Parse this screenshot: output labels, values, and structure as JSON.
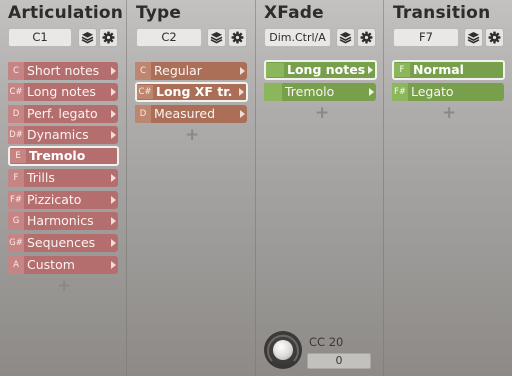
{
  "columns": [
    {
      "title": "Articulation",
      "selector_value": "C1",
      "items": [
        {
          "key": "C",
          "label": "Short notes",
          "active": false
        },
        {
          "key": "C#",
          "label": "Long notes",
          "active": false
        },
        {
          "key": "D",
          "label": "Perf. legato",
          "active": false
        },
        {
          "key": "D#",
          "label": "Dynamics",
          "active": false
        },
        {
          "key": "E",
          "label": "Tremolo",
          "active": true
        },
        {
          "key": "F",
          "label": "Trills",
          "active": false
        },
        {
          "key": "F#",
          "label": "Pizzicato",
          "active": false
        },
        {
          "key": "G",
          "label": "Harmonics",
          "active": false
        },
        {
          "key": "G#",
          "label": "Sequences",
          "active": false
        },
        {
          "key": "A",
          "label": "Custom",
          "active": false
        }
      ],
      "add_label": "+"
    },
    {
      "title": "Type",
      "selector_value": "C2",
      "items": [
        {
          "key": "C",
          "label": "Regular",
          "active": false
        },
        {
          "key": "C#",
          "label": "Long XF tr.",
          "active": true
        },
        {
          "key": "D",
          "label": "Measured",
          "active": false
        }
      ],
      "add_label": "+"
    },
    {
      "title": "XFade",
      "selector_value": "Dim.Ctrl/A",
      "items": [
        {
          "key": "",
          "label": "Long notes",
          "active": true
        },
        {
          "key": "",
          "label": "Tremolo",
          "active": false
        }
      ],
      "add_label": "+"
    },
    {
      "title": "Transition",
      "selector_value": "F7",
      "items": [
        {
          "key": "F",
          "label": "Normal",
          "active": true
        },
        {
          "key": "F#",
          "label": "Legato",
          "active": false
        }
      ],
      "add_label": "+"
    }
  ],
  "xfade_control": {
    "label": "CC 20",
    "value": "0"
  },
  "icons": {
    "layers": "layers-icon",
    "settings": "gear-icon",
    "arrow": "chevron-right-icon"
  },
  "colors": {
    "articulation": "#b56e6e",
    "type": "#ab6f58",
    "xfade": "#78a04c",
    "transition": "#78a04c",
    "active_border": "#f3f1ee"
  }
}
